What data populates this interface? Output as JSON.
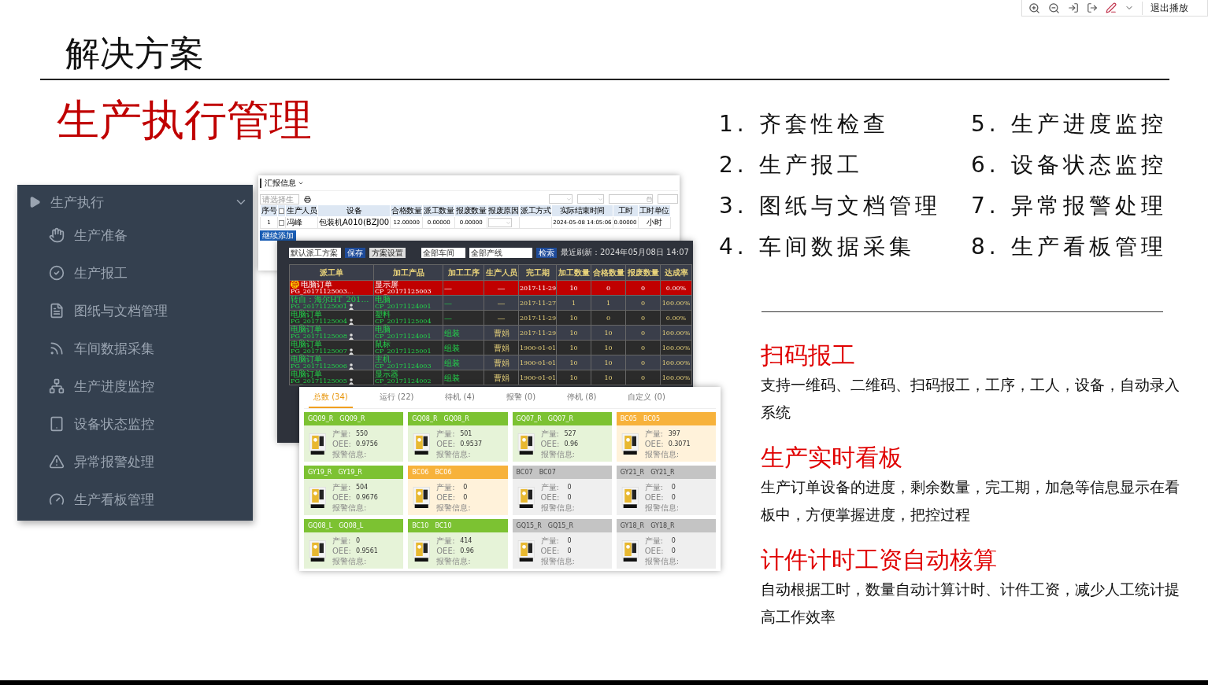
{
  "viewer_toolbar": {
    "exit_label": "退出播放"
  },
  "slide": {
    "title": "解决方案",
    "heading": "生产执行管理",
    "menu": {
      "title": "生产执行",
      "expanded": true,
      "items": [
        {
          "label": "生产准备"
        },
        {
          "label": "生产报工"
        },
        {
          "label": "图纸与文档管理"
        },
        {
          "label": "车间数据采集"
        },
        {
          "label": "生产进度监控"
        },
        {
          "label": "设备状态监控"
        },
        {
          "label": "异常报警处理"
        },
        {
          "label": "生产看板管理"
        }
      ]
    },
    "report_window": {
      "title": "汇报信息",
      "search_placeholder": "请选择生",
      "select_all_checked": false,
      "columns": [
        "序号",
        "生产人员",
        "设备",
        "合格数量",
        "派工数量",
        "报废数量",
        "报废原因",
        "派工方式",
        "实际结束时间",
        "工时",
        "工时单位"
      ],
      "rows": [
        {
          "no": "1",
          "checked": false,
          "person": "冯峰",
          "device": "包装机A010(BZJ00",
          "qualified": "12.00000",
          "dispatched": "0.00000",
          "scrapped": "0.00000",
          "end_time": "2024-05-08 14:05:06",
          "hours": "0.00000",
          "unit": "小时"
        }
      ],
      "add_button": "继续添加"
    },
    "dispatch_board": {
      "scheme": "默认派工方案",
      "save": "保存",
      "settings": "方案设置",
      "workshop": "全部车间",
      "line": "全部产线",
      "search": "检索",
      "refresh": "最近刷新：2024年05月08日 14:07",
      "columns": [
        "派工单",
        "加工产品",
        "加工工序",
        "生产人员",
        "完工期",
        "加工数量",
        "合格数量",
        "报废数量",
        "达成率"
      ],
      "rows": [
        {
          "urgent": true,
          "urgent_badge": "急",
          "order": "电脑订单",
          "order_no": "PG_20171125003…",
          "assigned": false,
          "product": "显示屏",
          "product_no": "CP_20171125003",
          "process": "—",
          "worker": "—",
          "due": "2017-11-29",
          "qty": "10",
          "ok": "0",
          "scrap": "0",
          "rate": "0.00%"
        },
        {
          "urgent": false,
          "order": "转自：海尔HT_201…",
          "order_no": "PG_20171125001",
          "assigned": true,
          "product": "电脑",
          "product_no": "CP_20171124001",
          "process": "—",
          "worker": "—",
          "due": "2017-11-27",
          "qty": "1",
          "ok": "1",
          "scrap": "0",
          "rate": "100.00%"
        },
        {
          "urgent": false,
          "order": "电脑订单",
          "order_no": "PG_20171125004",
          "assigned": true,
          "product": "塑料",
          "product_no": "CP_20171125004",
          "process": "—",
          "worker": "—",
          "due": "2017-11-29",
          "qty": "10",
          "ok": "0",
          "scrap": "0",
          "rate": "0.00%"
        },
        {
          "urgent": false,
          "order": "电脑订单",
          "order_no": "PG_20171125008",
          "assigned": true,
          "product": "电脑",
          "product_no": "CP_20171124001",
          "process": "组装",
          "worker": "曹娟",
          "due": "2017-11-29",
          "qty": "10",
          "ok": "10",
          "scrap": "0",
          "rate": "100.00%"
        },
        {
          "urgent": false,
          "order": "电脑订单",
          "order_no": "PG_20171125007",
          "assigned": true,
          "product": "鼠标",
          "product_no": "CP_20171125001",
          "process": "组装",
          "worker": "曹娟",
          "due": "1900-01-01",
          "qty": "10",
          "ok": "10",
          "scrap": "0",
          "rate": "100.00%"
        },
        {
          "urgent": false,
          "order": "电脑订单",
          "order_no": "PG_20171125006",
          "assigned": true,
          "product": "主机",
          "product_no": "CP_20171124003",
          "process": "组装",
          "worker": "曹娟",
          "due": "1900-01-01",
          "qty": "10",
          "ok": "10",
          "scrap": "0",
          "rate": "100.00%"
        },
        {
          "urgent": false,
          "order": "电脑订单",
          "order_no": "PG_20171125005",
          "assigned": true,
          "product": "显示器",
          "product_no": "CP_20171124002",
          "process": "组装",
          "worker": "曹娟",
          "due": "1900-01-01",
          "qty": "10",
          "ok": "10",
          "scrap": "0",
          "rate": "100.00%"
        }
      ]
    },
    "machine_board": {
      "tabs": [
        {
          "label": "总数 (34)",
          "selected": true
        },
        {
          "label": "运行 (22)",
          "selected": false
        },
        {
          "label": "待机 (4)",
          "selected": false
        },
        {
          "label": "报警 (0)",
          "selected": false
        },
        {
          "label": "停机 (8)",
          "selected": false
        },
        {
          "label": "自定义 (0)",
          "selected": false
        }
      ],
      "machines": [
        {
          "code": "GQ09_R",
          "name": "GQ09_R",
          "color": "#7cc232",
          "output_label": "产量:",
          "output": "550",
          "oee_label": "OEE:",
          "oee": "0.9756",
          "alarm_label": "报警信息:"
        },
        {
          "code": "GQ08_R",
          "name": "GQ08_R",
          "color": "#7cc232",
          "output_label": "产量:",
          "output": "501",
          "oee_label": "OEE:",
          "oee": "0.9537",
          "alarm_label": "报警信息:"
        },
        {
          "code": "GQ07_R",
          "name": "GQ07_R",
          "color": "#7cc232",
          "output_label": "产量:",
          "output": "527",
          "oee_label": "OEE:",
          "oee": "0.96",
          "alarm_label": "报警信息:"
        },
        {
          "code": "BC05",
          "name": "BC05",
          "color": "#f7b23b",
          "output_label": "产量:",
          "output": "397",
          "oee_label": "OEE:",
          "oee": "0.3071",
          "alarm_label": "报警信息:"
        },
        {
          "code": "GY19_R",
          "name": "GY19_R",
          "color": "#7cc232",
          "output_label": "产量:",
          "output": "504",
          "oee_label": "OEE:",
          "oee": "0.9676",
          "alarm_label": "报警信息:"
        },
        {
          "code": "BC06",
          "name": "BC06",
          "color": "#f7b23b",
          "output_label": "产量:",
          "output": "0",
          "oee_label": "OEE:",
          "oee": "0",
          "alarm_label": "报警信息:"
        },
        {
          "code": "BC07",
          "name": "BC07",
          "color": "#c4c4c4",
          "output_label": "产量:",
          "output": "0",
          "oee_label": "OEE:",
          "oee": "0",
          "alarm_label": "报警信息:"
        },
        {
          "code": "GY21_R",
          "name": "GY21_R",
          "color": "#c4c4c4",
          "output_label": "产量:",
          "output": "0",
          "oee_label": "OEE:",
          "oee": "0",
          "alarm_label": "报警信息:"
        },
        {
          "code": "GQ08_L",
          "name": "GQ08_L",
          "color": "#7cc232",
          "output_label": "产量:",
          "output": "0",
          "oee_label": "OEE:",
          "oee": "0.9561",
          "alarm_label": "报警信息:"
        },
        {
          "code": "BC10",
          "name": "BC10",
          "color": "#7cc232",
          "output_label": "产量:",
          "output": "414",
          "oee_label": "OEE:",
          "oee": "0.96",
          "alarm_label": "报警信息:"
        },
        {
          "code": "GQ15_R",
          "name": "GQ15_R",
          "color": "#c4c4c4",
          "output_label": "产量:",
          "output": "0",
          "oee_label": "OEE:",
          "oee": "0",
          "alarm_label": "报警信息:"
        },
        {
          "code": "GY18_R",
          "name": "GY18_R",
          "color": "#c4c4c4",
          "output_label": "产量:",
          "output": "0",
          "oee_label": "OEE:",
          "oee": "0",
          "alarm_label": "报警信息:"
        }
      ]
    },
    "features": [
      "1. 齐套性检查",
      "2. 生产报工",
      "3. 图纸与文档管理",
      "4. 车间数据采集",
      "5. 生产进度监控",
      "6. 设备状态监控",
      "7. 异常报警处理",
      "8. 生产看板管理"
    ],
    "highlights": [
      {
        "title": "扫码报工",
        "text": "支持一维码、二维码、扫码报工，工序，工人，设备，自动录入系统"
      },
      {
        "title": "生产实时看板",
        "text": "生产订单设备的进度，剩余数量，完工期，加急等信息显示在看板中，方便掌握进度，把控过程"
      },
      {
        "title": "计件计时工资自动核算",
        "text": "自动根据工时，数量自动计算计时、计件工资，减少人工统计提高工作效率"
      }
    ]
  }
}
